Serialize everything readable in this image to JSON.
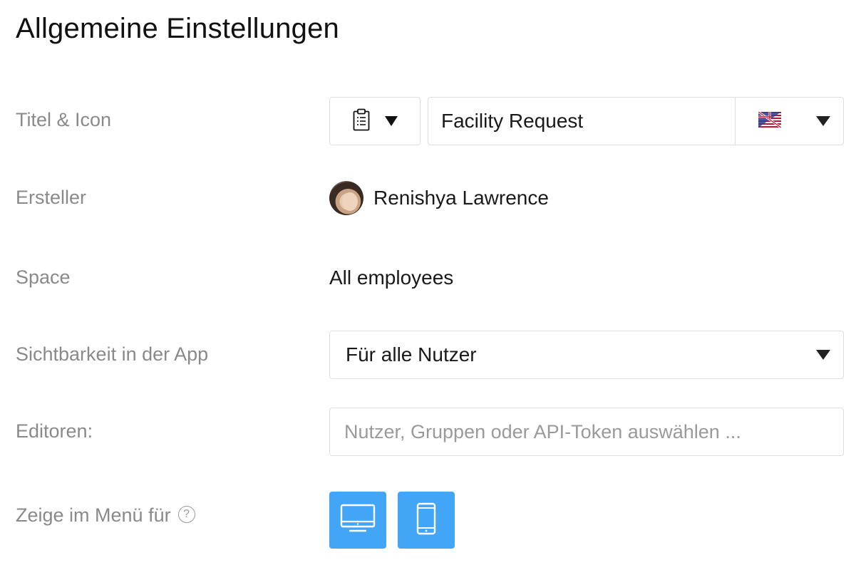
{
  "page": {
    "title": "Allgemeine Einstellungen"
  },
  "rows": {
    "title_icon": {
      "label": "Titel & Icon",
      "icon": "clipboard-icon",
      "title_value": "Facility Request",
      "language_flag": "us-uk-flag-icon"
    },
    "creator": {
      "label": "Ersteller",
      "name": "Renishya Lawrence"
    },
    "space": {
      "label": "Space",
      "value": "All employees"
    },
    "visibility": {
      "label": "Sichtbarkeit in der App",
      "selected": "Für alle Nutzer"
    },
    "editors": {
      "label": "Editoren:",
      "placeholder": "Nutzer, Gruppen oder API-Token auswählen ..."
    },
    "menu": {
      "label": "Zeige im Menü für",
      "help_glyph": "?",
      "desktop_icon": "desktop-icon",
      "mobile_icon": "mobile-icon"
    }
  },
  "colors": {
    "accent": "#42a5f5",
    "label": "#8a8a8a",
    "border": "#dedede"
  }
}
